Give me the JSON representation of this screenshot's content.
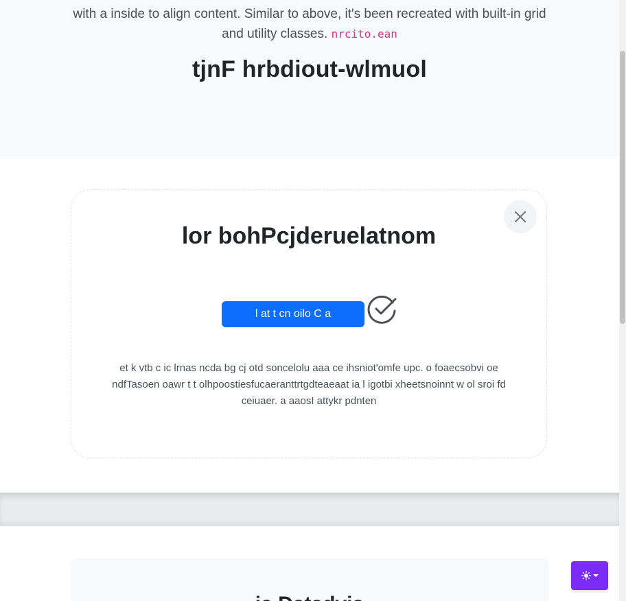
{
  "hero": {
    "lead_text": "with a inside to align content. Similar to above, it's been recreated with built-in grid and utility classes.",
    "lead_code": "nrcito.ean",
    "heading": "tjnF hrbdiout-wlmuol"
  },
  "modal": {
    "title": "lor bohPcjderuelatnom",
    "button_label": "l at t cn oilo C a",
    "body_text": "et k vtb c ic lrnas ncda bg cj otd soncelolu aaa ce ihsniot'omfe upc. o foaecsobvi oe ndfTasoen oawr t t olhpoostiesfucaeranttrtgdteaeaat ia l igotbi xheetsnoinnt w ol sroi fd ceiuaer. a aaosI attykr pdnten",
    "close_icon": "close-icon",
    "check_icon": "check-circle-icon",
    "accent_color": "#0d6efd"
  },
  "bottom": {
    "heading": "ia Datadvia"
  },
  "theme_toggle": {
    "icon": "sun-icon",
    "caret_icon": "caret-down-icon",
    "color": "#7a2cf6"
  }
}
